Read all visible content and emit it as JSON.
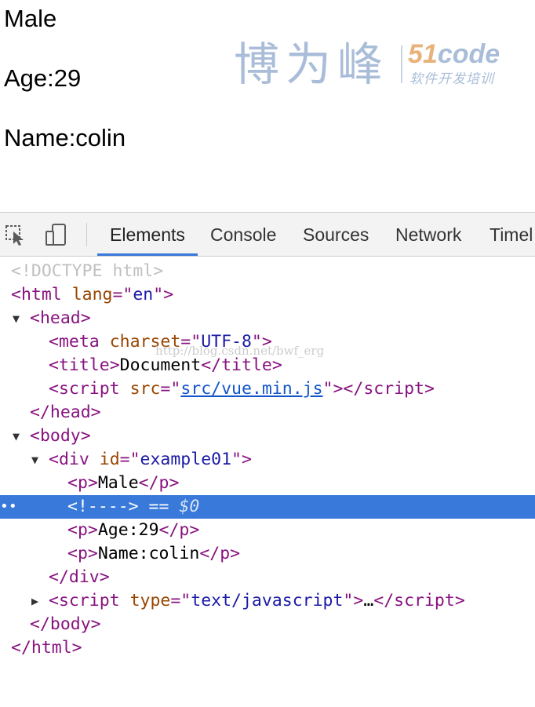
{
  "page": {
    "paragraphs": [
      "Male",
      "Age:29",
      "Name:colin"
    ],
    "logo": {
      "chinese": "博为峰",
      "code_num": "51",
      "code_word": "code",
      "tagline": "软件开发培训"
    }
  },
  "devtools": {
    "tabs": [
      "Elements",
      "Console",
      "Sources",
      "Network",
      "Timel"
    ],
    "active_tab": "Elements",
    "icons": [
      "inspect-element-icon",
      "device-toolbar-icon"
    ],
    "colors": {
      "tag": "#881280",
      "attr": "#994500",
      "value": "#1a1aa6",
      "selection": "#3879d9",
      "accent": "#3879d9"
    }
  },
  "tree": {
    "doctype": "<!DOCTYPE html>",
    "html_open": "html",
    "html_lang_attr": "lang",
    "html_lang_val": "en",
    "head": "head",
    "meta": "meta",
    "charset_attr": "charset",
    "charset_val": "UTF-8",
    "title": "title",
    "title_text": "Document",
    "script": "script",
    "src_attr": "src",
    "src_val": "src/vue.min.js",
    "body": "body",
    "div": "div",
    "id_attr": "id",
    "id_val": "example01",
    "p": "p",
    "p1_text": "Male",
    "comment": "<!---->",
    "comment_suffix": " == ",
    "dollar": "$0",
    "p2_text": "Age:29",
    "p3_text": "Name:colin",
    "type_attr": "type",
    "type_val": "text/javascript",
    "ellipsis": "…",
    "selection_dots": "••"
  },
  "watermark": "http://blog.csdn.net/bwf_erg"
}
